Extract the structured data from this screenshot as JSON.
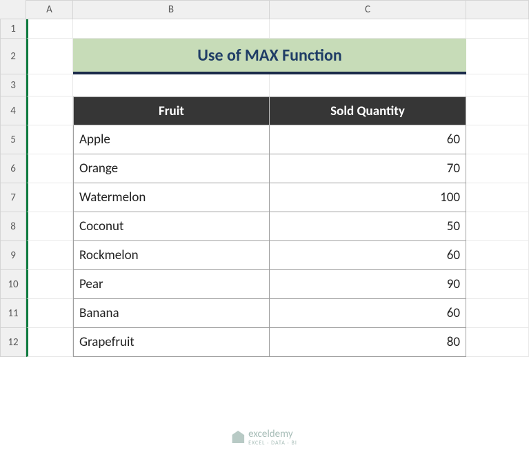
{
  "columns": [
    "",
    "A",
    "B",
    "C",
    ""
  ],
  "rows": [
    "1",
    "2",
    "3",
    "4",
    "5",
    "6",
    "7",
    "8",
    "9",
    "10",
    "11",
    "12"
  ],
  "title": "Use of MAX Function",
  "headers": {
    "fruit": "Fruit",
    "qty": "Sold Quantity"
  },
  "data": [
    {
      "fruit": "Apple",
      "qty": 60
    },
    {
      "fruit": "Orange",
      "qty": 70
    },
    {
      "fruit": "Watermelon",
      "qty": 100
    },
    {
      "fruit": "Coconut",
      "qty": 50
    },
    {
      "fruit": "Rockmelon",
      "qty": 60
    },
    {
      "fruit": "Pear",
      "qty": 90
    },
    {
      "fruit": "Banana",
      "qty": 60
    },
    {
      "fruit": "Grapefruit",
      "qty": 80
    }
  ],
  "watermark": {
    "brand": "exceldemy",
    "tagline": "EXCEL · DATA · BI"
  },
  "chart_data": {
    "type": "table",
    "title": "Use of MAX Function",
    "columns": [
      "Fruit",
      "Sold Quantity"
    ],
    "rows": [
      [
        "Apple",
        60
      ],
      [
        "Orange",
        70
      ],
      [
        "Watermelon",
        100
      ],
      [
        "Coconut",
        50
      ],
      [
        "Rockmelon",
        60
      ],
      [
        "Pear",
        90
      ],
      [
        "Banana",
        60
      ],
      [
        "Grapefruit",
        80
      ]
    ]
  }
}
